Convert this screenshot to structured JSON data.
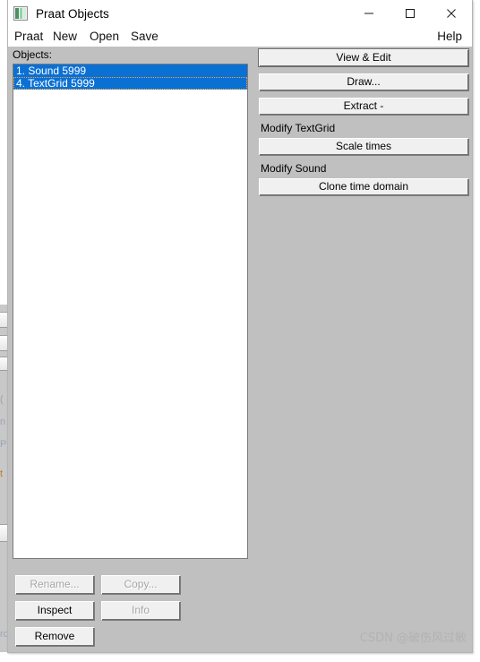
{
  "window": {
    "title": "Praat Objects",
    "icon": "praat-app-icon",
    "controls": {
      "minimize": "minimize-icon",
      "maximize": "maximize-icon",
      "close": "close-icon"
    }
  },
  "menubar": {
    "items": [
      {
        "label": "Praat"
      },
      {
        "label": "New"
      },
      {
        "label": "Open"
      },
      {
        "label": "Save"
      }
    ],
    "help": "Help"
  },
  "objects": {
    "label": "Objects:",
    "items": [
      {
        "text": "1. Sound 5999",
        "selected": true,
        "focused": false
      },
      {
        "text": "4. TextGrid 5999",
        "selected": true,
        "focused": true
      }
    ]
  },
  "commands": {
    "view_edit": "View & Edit",
    "draw": "Draw...",
    "extract": "Extract -",
    "modify_textgrid_label": "Modify TextGrid",
    "scale_times": "Scale times",
    "modify_sound_label": "Modify Sound",
    "clone_time_domain": "Clone time domain"
  },
  "fixed_buttons": {
    "rename": "Rename...",
    "copy": "Copy...",
    "inspect": "Inspect",
    "info": "Info",
    "remove": "Remove"
  },
  "watermark": "CSDN @破伤风过敏",
  "colors": {
    "selection_blue": "#0a70d4",
    "window_face": "#c0c0c0",
    "button_face": "#f0f0f0",
    "focus_dotted": "#f2a23c",
    "watermark_gray": "#b2b2b2"
  },
  "background_window": {
    "ghost_fragments": [
      "...",
      "(",
      "n",
      "P",
      "t",
      "rd"
    ]
  }
}
